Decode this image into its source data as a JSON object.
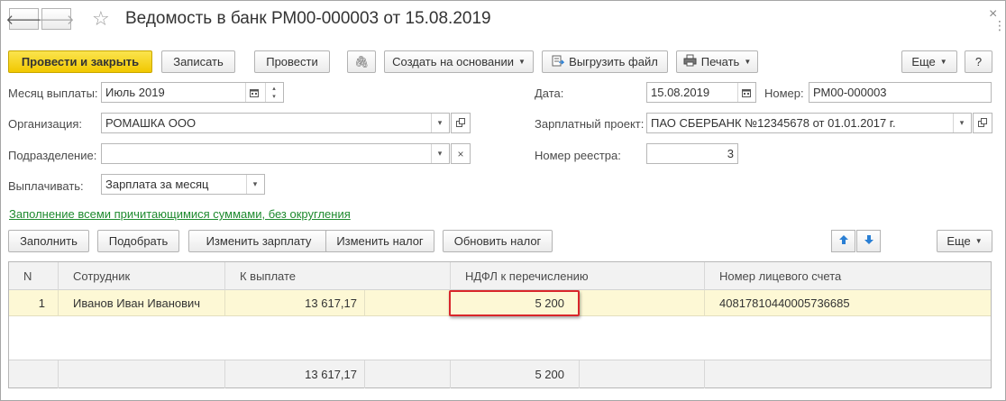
{
  "window": {
    "title": "Ведомость в банк РМ00-000003 от 15.08.2019",
    "back_glyph": "🡐",
    "forward_glyph": "🡒",
    "star_glyph": "☆",
    "close_glyph": "×",
    "menu_glyph": "⋮"
  },
  "toolbar": {
    "post_and_close": "Провести и закрыть",
    "save": "Записать",
    "post": "Провести",
    "attach_glyph": "🖇",
    "create_based_on": "Создать на основании",
    "export_file": "Выгрузить файл",
    "print": "Печать",
    "more": "Еще",
    "help": "?",
    "caret": "▼"
  },
  "form": {
    "pay_month_label": "Месяц выплаты:",
    "pay_month_value": "Июль 2019",
    "organization_label": "Организация:",
    "organization_value": "РОМАШКА ООО",
    "department_label": "Подразделение:",
    "department_value": "",
    "pay_type_label": "Выплачивать:",
    "pay_type_value": "Зарплата за месяц",
    "date_label": "Дата:",
    "date_value": "15.08.2019",
    "number_label": "Номер:",
    "number_value": "РМ00-000003",
    "salary_project_label": "Зарплатный проект:",
    "salary_project_value": "ПАО СБЕРБАНК №12345678 от 01.01.2017 г.",
    "registry_number_label": "Номер реестра:",
    "registry_number_value": "3",
    "fill_link": "Заполнение всеми причитающимися суммами, без округления"
  },
  "table_toolbar": {
    "fill": "Заполнить",
    "pick": "Подобрать",
    "change_salary": "Изменить зарплату",
    "change_tax": "Изменить налог",
    "update_tax": "Обновить налог",
    "more": "Еще"
  },
  "table": {
    "columns": [
      "N",
      "Сотрудник",
      "К выплате",
      "НДФЛ к перечислению",
      "Номер лицевого счета"
    ],
    "rows": [
      {
        "n": "1",
        "employee": "Иванов Иван Иванович",
        "to_pay": "13 617,17",
        "ndfl": "5 200",
        "account": "40817810440005736685"
      }
    ],
    "totals": {
      "to_pay": "13 617,17",
      "ndfl": "5 200"
    }
  },
  "colors": {
    "primary_button": "#f5d20f",
    "selected_row": "#fdf8d5",
    "link": "#1e8a2e",
    "highlight": "#d9262b",
    "arrow_icon": "#2a7fd4"
  }
}
